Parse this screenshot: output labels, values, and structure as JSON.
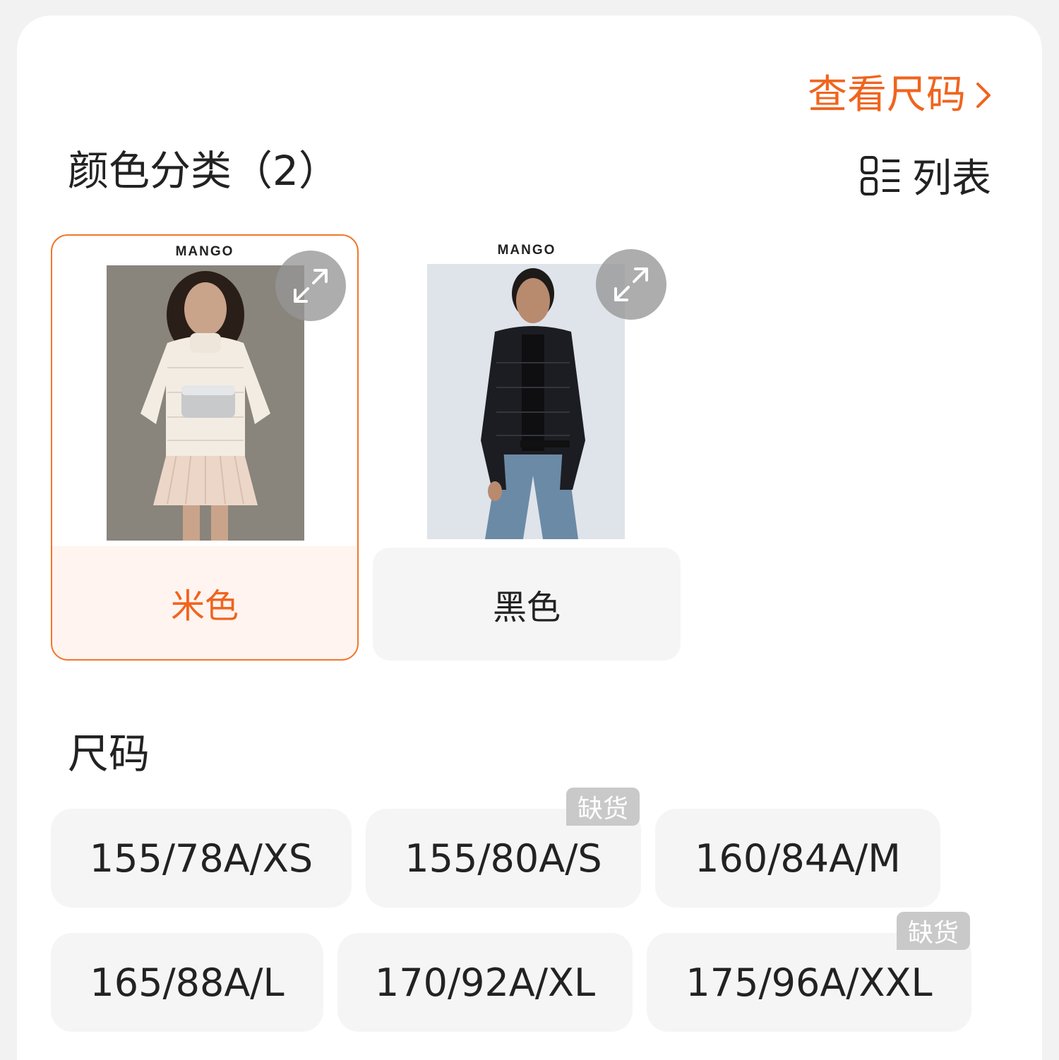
{
  "header": {
    "size_guide_label": "查看尺码",
    "size_guide_icon": "chevron-right-icon",
    "accent_color": "#f0641e"
  },
  "color_section": {
    "title": "颜色分类（2）",
    "view_toggle_label": "列表",
    "view_toggle_icon": "list-view-icon",
    "options": [
      {
        "brand": "MANGO",
        "label": "米色",
        "selected": true,
        "image": "model in beige puffer jacket with silver bag",
        "expand_icon": "expand-icon"
      },
      {
        "brand": "MANGO",
        "label": "黑色",
        "selected": false,
        "image": "model in black puffer jacket and jeans",
        "expand_icon": "expand-icon"
      }
    ]
  },
  "size_section": {
    "title": "尺码",
    "out_of_stock_label": "缺货",
    "sizes": [
      {
        "label": "155/78A/XS",
        "out_of_stock": false
      },
      {
        "label": "155/80A/S",
        "out_of_stock": true
      },
      {
        "label": "160/84A/M",
        "out_of_stock": false
      },
      {
        "label": "165/88A/L",
        "out_of_stock": false
      },
      {
        "label": "170/92A/XL",
        "out_of_stock": false
      },
      {
        "label": "175/96A/XXL",
        "out_of_stock": true
      }
    ]
  }
}
